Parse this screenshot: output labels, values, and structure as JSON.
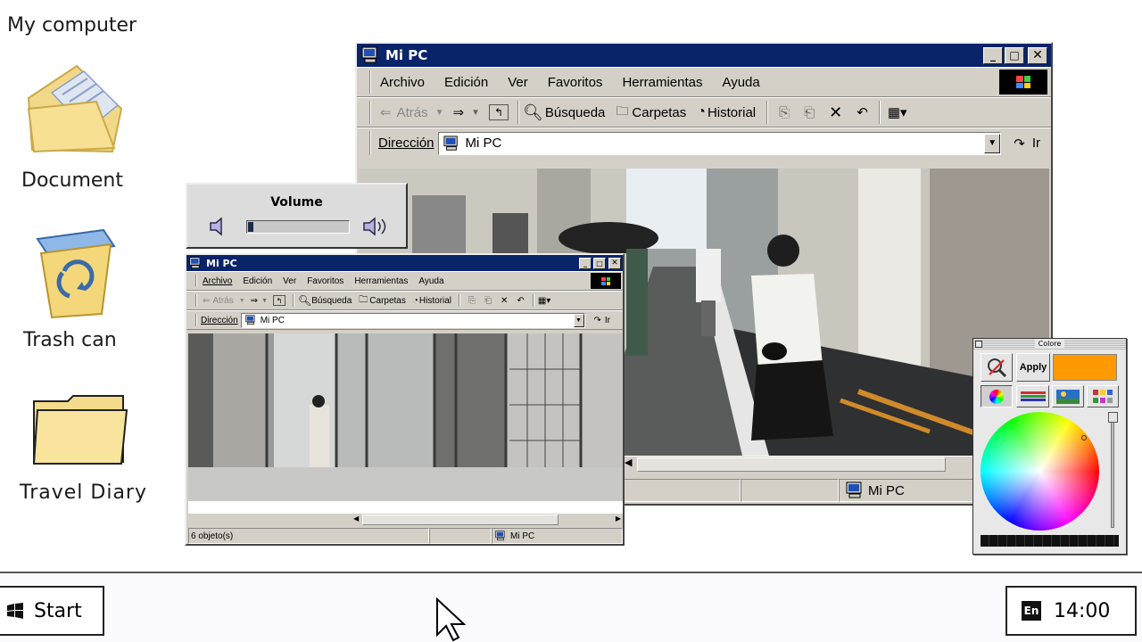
{
  "desktop": {
    "icons": [
      {
        "label": "My computer"
      },
      {
        "label": "Document"
      },
      {
        "label": "Trash can"
      },
      {
        "label": "Travel Diary"
      }
    ]
  },
  "taskbar": {
    "start_label": "Start",
    "lang": "En",
    "clock": "14:00"
  },
  "volume": {
    "title": "Volume",
    "level": 0.05
  },
  "main_window": {
    "title": "Mi PC",
    "menu": [
      "Archivo",
      "Edición",
      "Ver",
      "Favoritos",
      "Herramientas",
      "Ayuda"
    ],
    "toolbar": {
      "back": "Atrás",
      "search": "Búsqueda",
      "folders": "Carpetas",
      "history": "Historial"
    },
    "address_label": "Dirección",
    "address_value": "Mi PC",
    "go_label": "Ir",
    "status_location": "Mi PC"
  },
  "small_window": {
    "title": "Mi PC",
    "menu": [
      "Archivo",
      "Edición",
      "Ver",
      "Favoritos",
      "Herramientas",
      "Ayuda"
    ],
    "toolbar": {
      "back": "Atrás",
      "search": "Búsqueda",
      "folders": "Carpetas",
      "history": "Historial"
    },
    "address_label": "Dirección",
    "address_value": "Mi PC",
    "go_label": "Ir",
    "status_objects": "6 objeto(s)",
    "status_location": "Mi PC"
  },
  "colors_panel": {
    "title": "Colore",
    "apply_label": "Apply",
    "selected_color": "#ff9900"
  },
  "colors": {
    "titlebar": "#0a246a",
    "window_face": "#d4d0c8",
    "selected": "#ff9900"
  }
}
